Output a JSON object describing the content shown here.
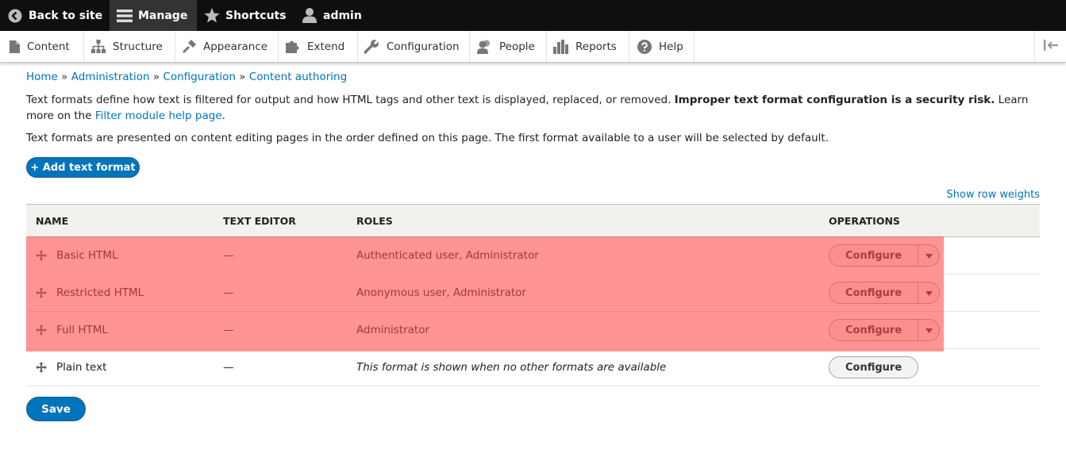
{
  "toolbar": {
    "back": "Back to site",
    "manage": "Manage",
    "shortcuts": "Shortcuts",
    "user": "admin"
  },
  "tray": {
    "items": [
      "Content",
      "Structure",
      "Appearance",
      "Extend",
      "Configuration",
      "People",
      "Reports",
      "Help"
    ]
  },
  "breadcrumb": [
    "Home",
    "Administration",
    "Configuration",
    "Content authoring"
  ],
  "help": {
    "p1_a": "Text formats define how text is filtered for output and how HTML tags and other text is displayed, replaced, or removed. ",
    "p1_strong": "Improper text format configuration is a security risk.",
    "p1_b": " Learn more on the ",
    "p1_link": "Filter module help page",
    "p1_end": ".",
    "p2": "Text formats are presented on content editing pages in the order defined on this page. The first format available to a user will be selected by default."
  },
  "add_button": "+ Add text format",
  "show_row_weights": "Show row weights",
  "table": {
    "headers": [
      "Name",
      "Text editor",
      "Roles",
      "Operations"
    ],
    "rows": [
      {
        "name": "Basic HTML",
        "editor": "—",
        "roles": "Authenticated user, Administrator",
        "op": "Configure"
      },
      {
        "name": "Restricted HTML",
        "editor": "—",
        "roles": "Anonymous user, Administrator",
        "op": "Configure"
      },
      {
        "name": "Full HTML",
        "editor": "—",
        "roles": "Administrator",
        "op": "Configure"
      },
      {
        "name": "Plain text",
        "editor": "—",
        "roles": "This format is shown when no other formats are available",
        "op": "Configure"
      }
    ]
  },
  "save_button": "Save",
  "colors": {
    "toolbar_bg": "#0f0f0f",
    "link": "#0074bd",
    "primary_button": "#0074bd",
    "highlight": "#ff4646"
  }
}
